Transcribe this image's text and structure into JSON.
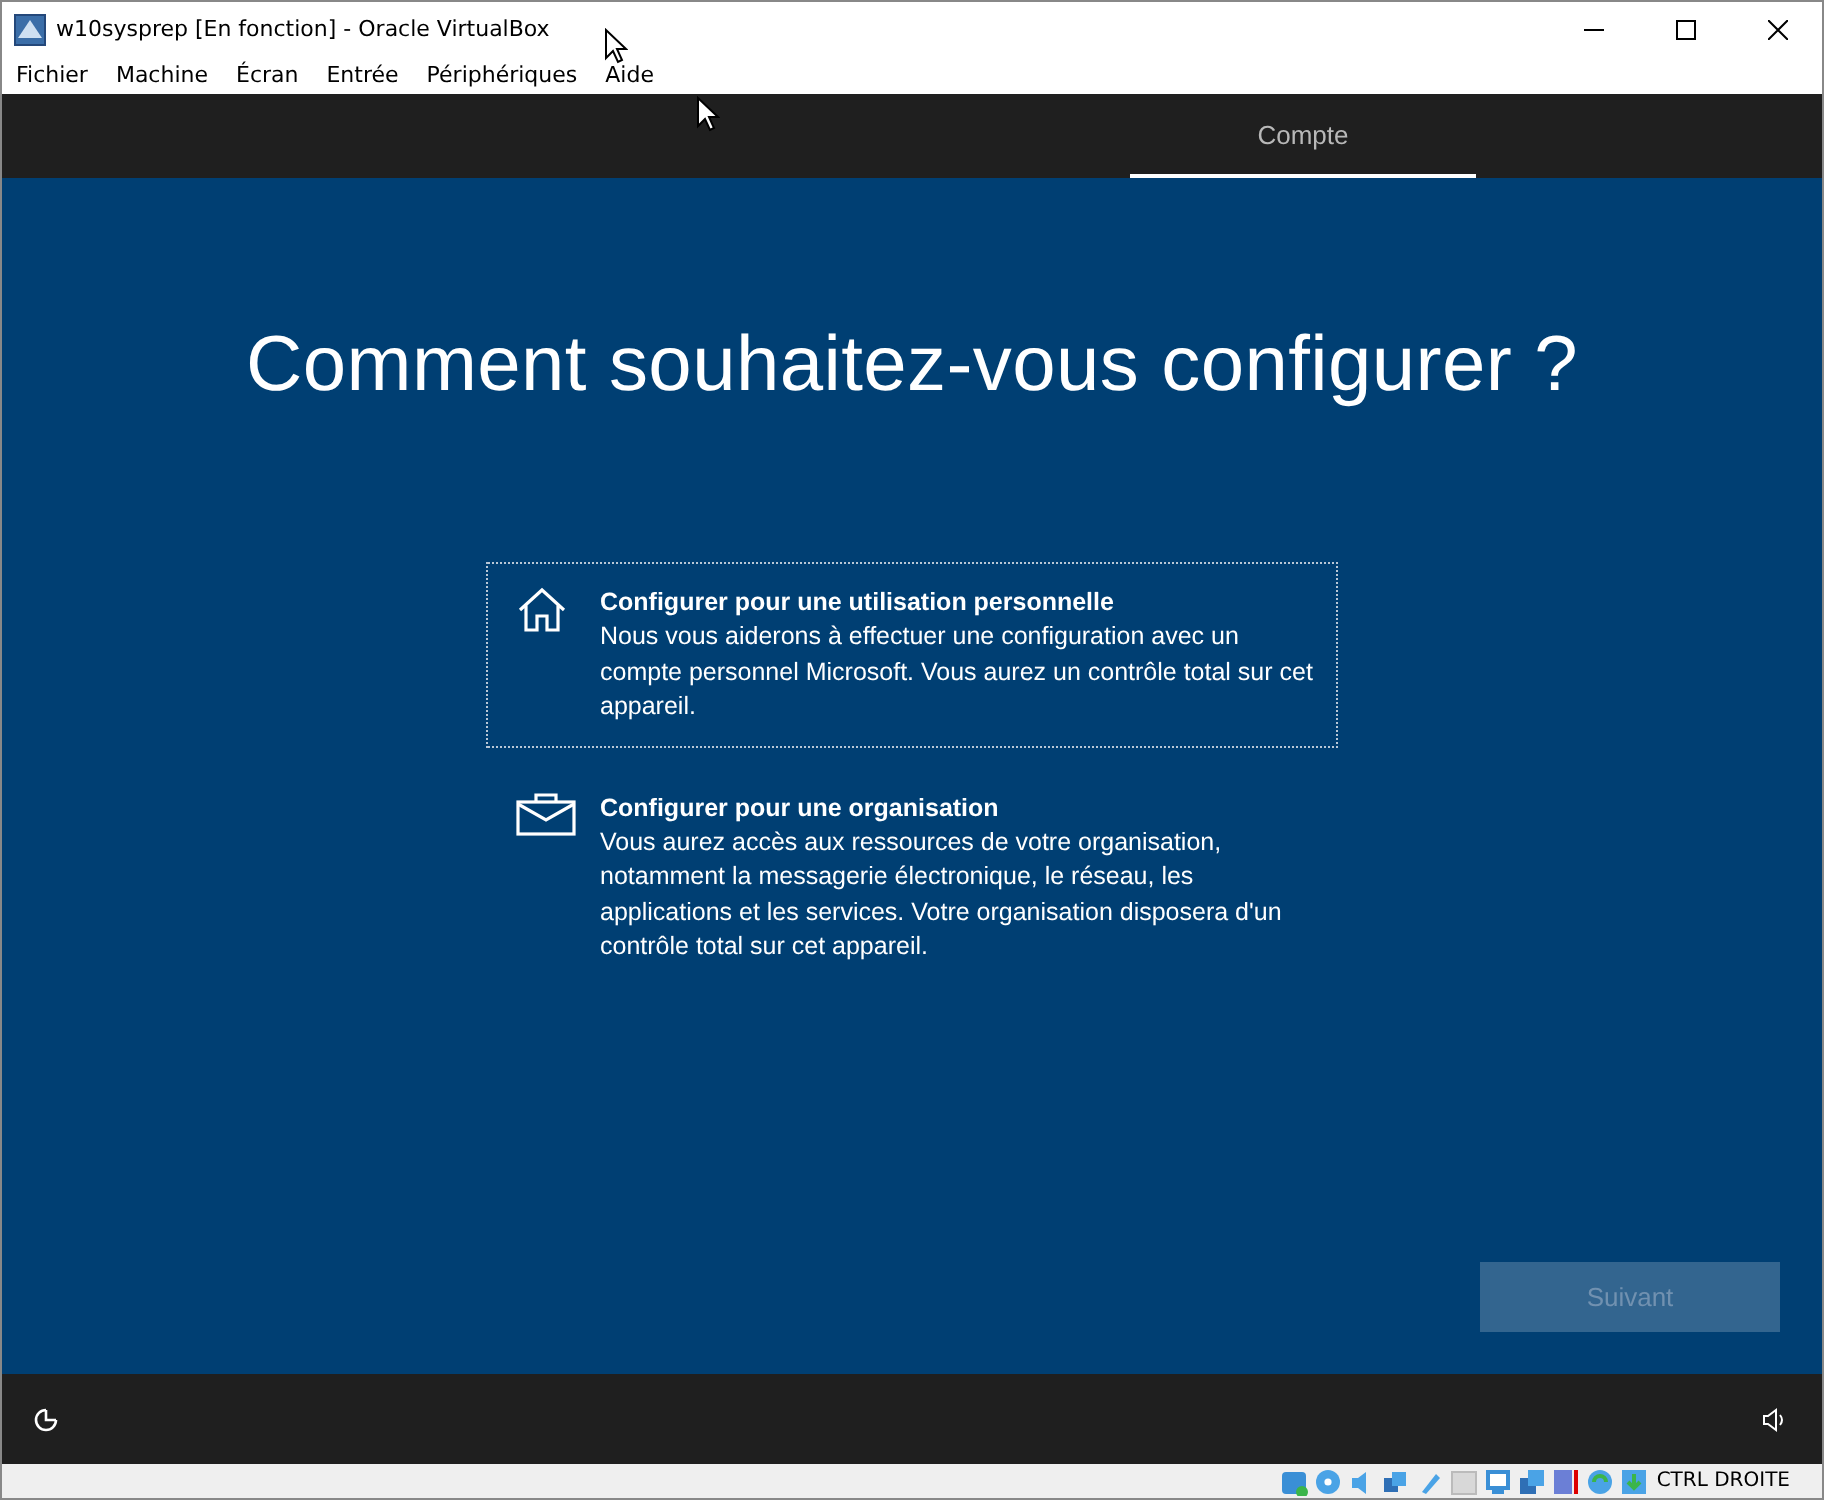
{
  "window": {
    "title": "w10sysprep [En fonction] - Oracle VirtualBox"
  },
  "menu": [
    "Fichier",
    "Machine",
    "Écran",
    "Entrée",
    "Périphériques",
    "Aide"
  ],
  "tabs": [
    {
      "label": "Compte",
      "selected": true
    }
  ],
  "heading": "Comment souhaitez-vous configurer ?",
  "options": [
    {
      "kind": "home",
      "title": "Configurer pour une utilisation personnelle",
      "description": "Nous vous aiderons à effectuer une configuration avec un compte personnel Microsoft. Vous aurez un contrôle total sur cet appareil.",
      "selected": true
    },
    {
      "kind": "work",
      "title": "Configurer pour une organisation",
      "description": "Vous aurez accès aux ressources de votre organisation, notamment la messagerie électronique, le réseau, les applications et les services. Votre organisation disposera d'un contrôle total sur cet appareil.",
      "selected": false
    }
  ],
  "next_button": {
    "label": "Suivant",
    "disabled": true
  },
  "status_bar": {
    "host_key": "CTRL DROITE"
  }
}
